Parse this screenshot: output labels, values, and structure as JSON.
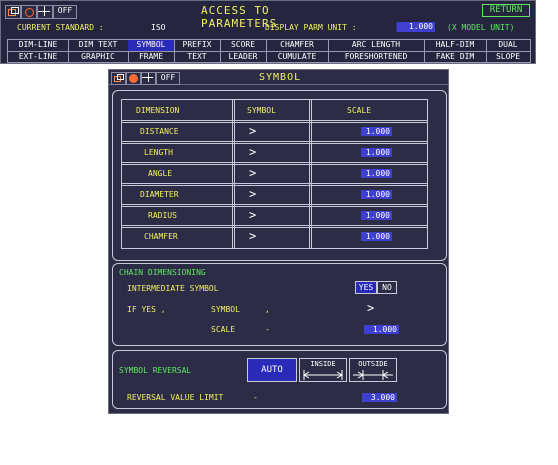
{
  "header": {
    "title": "ACCESS TO PARAMETERS",
    "return_label": "RETURN",
    "off_label": "OFF",
    "current_standard_label": "CURRENT STANDARD :",
    "current_standard_value": "ISO",
    "display_parm_label": "DISPLAY PARM UNIT :",
    "display_parm_value": "1.000",
    "model_unit_label": "(X MODEL UNIT)"
  },
  "tabs_row1": [
    "DIM-LINE",
    "DIM TEXT",
    "SYMBOL",
    "PREFIX",
    "SCORE",
    "CHAMFER",
    "ARC LENGTH",
    "HALF-DIM",
    "DUAL"
  ],
  "tabs_row2": [
    "EXT-LINE",
    "GRAPHIC",
    "FRAME",
    "TEXT",
    "LEADER",
    "CUMULATE",
    "FORESHORTENED",
    "FAKE DIM",
    "SLOPE"
  ],
  "selected_tab": "SYMBOL",
  "panel": {
    "title": "SYMBOL",
    "off_label": "OFF",
    "table": {
      "headers": [
        "DIMENSION",
        "SYMBOL",
        "SCALE"
      ],
      "rows": [
        {
          "name": "DISTANCE",
          "symbol": ">",
          "scale": "1.000"
        },
        {
          "name": "LENGTH",
          "symbol": ">",
          "scale": "1.000"
        },
        {
          "name": "ANGLE",
          "symbol": ">",
          "scale": "1.000"
        },
        {
          "name": "DIAMETER",
          "symbol": ">",
          "scale": "1.000"
        },
        {
          "name": "RADIUS",
          "symbol": ">",
          "scale": "1.000"
        },
        {
          "name": "CHAMFER",
          "symbol": ">",
          "scale": "1.000"
        }
      ]
    },
    "chain": {
      "title": "CHAIN DIMENSIONING",
      "intermediate_label": "INTERMEDIATE SYMBOL",
      "yes_label": "YES",
      "no_label": "NO",
      "if_yes_label": "IF YES ,",
      "symbol_label": "SYMBOL",
      "symbol_sep": ",",
      "symbol_value": ">",
      "scale_label": "SCALE",
      "scale_sep": "-",
      "scale_value": "1.000"
    },
    "reversal": {
      "title": "SYMBOL REVERSAL",
      "auto_label": "AUTO",
      "inside_label": "INSIDE",
      "outside_label": "OUTSIDE",
      "limit_label": "REVERSAL VALUE LIMIT",
      "limit_sep": "-",
      "limit_value": "3.000"
    }
  },
  "colors": {
    "panel_bg": "#2c2c46",
    "label_yellow": "#f0f060",
    "selection_blue": "#2a2ab8",
    "return_green": "#5fe85f"
  }
}
